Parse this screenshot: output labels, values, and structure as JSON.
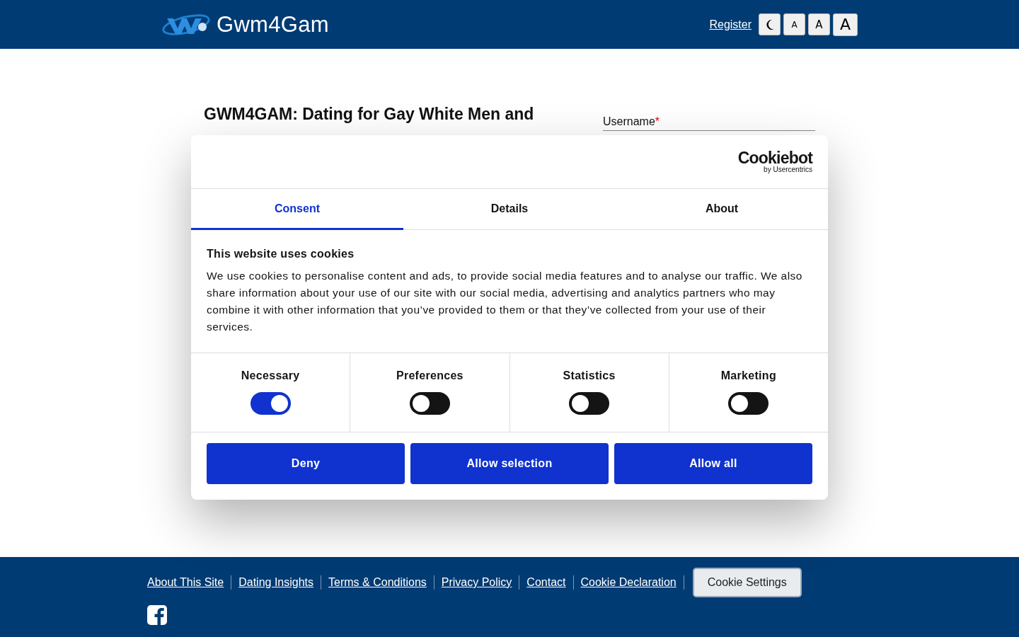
{
  "header": {
    "brand": "Gwm4Gam",
    "register_link": "Register",
    "display_buttons": [
      {
        "kind": "dark-mode"
      },
      {
        "kind": "small",
        "label": "A"
      },
      {
        "kind": "medium",
        "label": "A"
      },
      {
        "kind": "large",
        "label": "A"
      }
    ]
  },
  "main": {
    "heading": "GWM4GAM: Dating for Gay White Men and",
    "form": {
      "username_label": "Username",
      "required_mark": "*"
    }
  },
  "cookie_dialog": {
    "logo": {
      "name": "Cookiebot",
      "byline": "by Usercentrics"
    },
    "tabs": [
      {
        "label": "Consent",
        "selected": true
      },
      {
        "label": "Details",
        "selected": false
      },
      {
        "label": "About",
        "selected": false
      }
    ],
    "title": "This website uses cookies",
    "text": "We use cookies to personalise content and ads, to provide social media features and to analyse our traffic. We also share information about your use of our site with our social media, advertising and analytics partners who may combine it with other information that you’ve provided to them or that they’ve collected from your use of their services.",
    "categories": [
      {
        "label": "Necessary",
        "checked": true
      },
      {
        "label": "Preferences",
        "checked": false
      },
      {
        "label": "Statistics",
        "checked": false
      },
      {
        "label": "Marketing",
        "checked": false
      }
    ],
    "buttons": [
      "Deny",
      "Allow selection",
      "Allow all"
    ]
  },
  "footer": {
    "links": [
      "About This Site",
      "Dating Insights",
      "Terms & Conditions",
      "Privacy Policy",
      "Contact",
      "Cookie Declaration"
    ],
    "cookie_settings_button": "Cookie Settings"
  }
}
